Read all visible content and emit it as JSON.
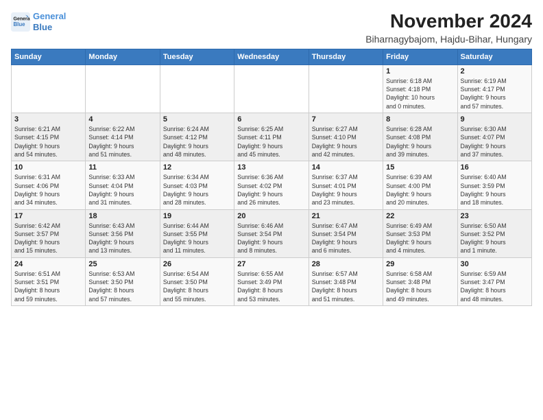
{
  "logo": {
    "line1": "General",
    "line2": "Blue"
  },
  "title": "November 2024",
  "subtitle": "Biharnagybajom, Hajdu-Bihar, Hungary",
  "weekdays": [
    "Sunday",
    "Monday",
    "Tuesday",
    "Wednesday",
    "Thursday",
    "Friday",
    "Saturday"
  ],
  "weeks": [
    [
      {
        "day": "",
        "detail": ""
      },
      {
        "day": "",
        "detail": ""
      },
      {
        "day": "",
        "detail": ""
      },
      {
        "day": "",
        "detail": ""
      },
      {
        "day": "",
        "detail": ""
      },
      {
        "day": "1",
        "detail": "Sunrise: 6:18 AM\nSunset: 4:18 PM\nDaylight: 10 hours\nand 0 minutes."
      },
      {
        "day": "2",
        "detail": "Sunrise: 6:19 AM\nSunset: 4:17 PM\nDaylight: 9 hours\nand 57 minutes."
      }
    ],
    [
      {
        "day": "3",
        "detail": "Sunrise: 6:21 AM\nSunset: 4:15 PM\nDaylight: 9 hours\nand 54 minutes."
      },
      {
        "day": "4",
        "detail": "Sunrise: 6:22 AM\nSunset: 4:14 PM\nDaylight: 9 hours\nand 51 minutes."
      },
      {
        "day": "5",
        "detail": "Sunrise: 6:24 AM\nSunset: 4:12 PM\nDaylight: 9 hours\nand 48 minutes."
      },
      {
        "day": "6",
        "detail": "Sunrise: 6:25 AM\nSunset: 4:11 PM\nDaylight: 9 hours\nand 45 minutes."
      },
      {
        "day": "7",
        "detail": "Sunrise: 6:27 AM\nSunset: 4:10 PM\nDaylight: 9 hours\nand 42 minutes."
      },
      {
        "day": "8",
        "detail": "Sunrise: 6:28 AM\nSunset: 4:08 PM\nDaylight: 9 hours\nand 39 minutes."
      },
      {
        "day": "9",
        "detail": "Sunrise: 6:30 AM\nSunset: 4:07 PM\nDaylight: 9 hours\nand 37 minutes."
      }
    ],
    [
      {
        "day": "10",
        "detail": "Sunrise: 6:31 AM\nSunset: 4:06 PM\nDaylight: 9 hours\nand 34 minutes."
      },
      {
        "day": "11",
        "detail": "Sunrise: 6:33 AM\nSunset: 4:04 PM\nDaylight: 9 hours\nand 31 minutes."
      },
      {
        "day": "12",
        "detail": "Sunrise: 6:34 AM\nSunset: 4:03 PM\nDaylight: 9 hours\nand 28 minutes."
      },
      {
        "day": "13",
        "detail": "Sunrise: 6:36 AM\nSunset: 4:02 PM\nDaylight: 9 hours\nand 26 minutes."
      },
      {
        "day": "14",
        "detail": "Sunrise: 6:37 AM\nSunset: 4:01 PM\nDaylight: 9 hours\nand 23 minutes."
      },
      {
        "day": "15",
        "detail": "Sunrise: 6:39 AM\nSunset: 4:00 PM\nDaylight: 9 hours\nand 20 minutes."
      },
      {
        "day": "16",
        "detail": "Sunrise: 6:40 AM\nSunset: 3:59 PM\nDaylight: 9 hours\nand 18 minutes."
      }
    ],
    [
      {
        "day": "17",
        "detail": "Sunrise: 6:42 AM\nSunset: 3:57 PM\nDaylight: 9 hours\nand 15 minutes."
      },
      {
        "day": "18",
        "detail": "Sunrise: 6:43 AM\nSunset: 3:56 PM\nDaylight: 9 hours\nand 13 minutes."
      },
      {
        "day": "19",
        "detail": "Sunrise: 6:44 AM\nSunset: 3:55 PM\nDaylight: 9 hours\nand 11 minutes."
      },
      {
        "day": "20",
        "detail": "Sunrise: 6:46 AM\nSunset: 3:54 PM\nDaylight: 9 hours\nand 8 minutes."
      },
      {
        "day": "21",
        "detail": "Sunrise: 6:47 AM\nSunset: 3:54 PM\nDaylight: 9 hours\nand 6 minutes."
      },
      {
        "day": "22",
        "detail": "Sunrise: 6:49 AM\nSunset: 3:53 PM\nDaylight: 9 hours\nand 4 minutes."
      },
      {
        "day": "23",
        "detail": "Sunrise: 6:50 AM\nSunset: 3:52 PM\nDaylight: 9 hours\nand 1 minute."
      }
    ],
    [
      {
        "day": "24",
        "detail": "Sunrise: 6:51 AM\nSunset: 3:51 PM\nDaylight: 8 hours\nand 59 minutes."
      },
      {
        "day": "25",
        "detail": "Sunrise: 6:53 AM\nSunset: 3:50 PM\nDaylight: 8 hours\nand 57 minutes."
      },
      {
        "day": "26",
        "detail": "Sunrise: 6:54 AM\nSunset: 3:50 PM\nDaylight: 8 hours\nand 55 minutes."
      },
      {
        "day": "27",
        "detail": "Sunrise: 6:55 AM\nSunset: 3:49 PM\nDaylight: 8 hours\nand 53 minutes."
      },
      {
        "day": "28",
        "detail": "Sunrise: 6:57 AM\nSunset: 3:48 PM\nDaylight: 8 hours\nand 51 minutes."
      },
      {
        "day": "29",
        "detail": "Sunrise: 6:58 AM\nSunset: 3:48 PM\nDaylight: 8 hours\nand 49 minutes."
      },
      {
        "day": "30",
        "detail": "Sunrise: 6:59 AM\nSunset: 3:47 PM\nDaylight: 8 hours\nand 48 minutes."
      }
    ]
  ]
}
